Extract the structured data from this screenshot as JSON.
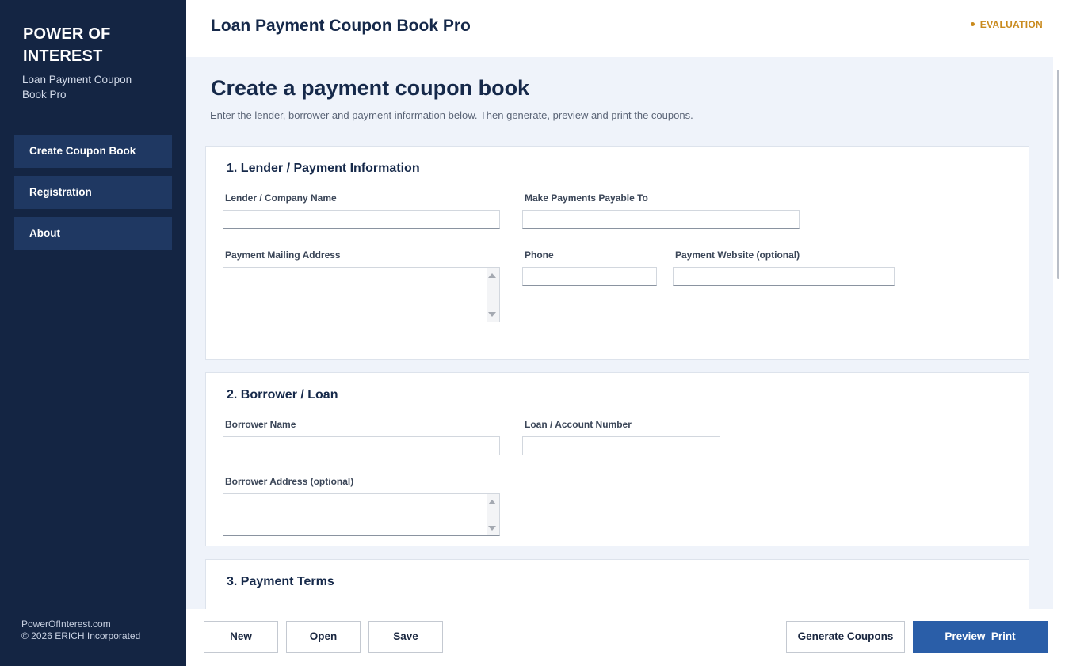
{
  "sidebar": {
    "brand_title": "POWER OF INTEREST",
    "brand_subtitle": "Loan Payment Coupon Book Pro",
    "items": [
      {
        "label": "Create Coupon Book"
      },
      {
        "label": "Registration"
      },
      {
        "label": "About"
      }
    ],
    "footer_website": "PowerOfInterest.com",
    "footer_copyright": "© 2026 ERICH Incorporated"
  },
  "header": {
    "title": "Loan Payment Coupon Book Pro",
    "badge": "EVALUATION"
  },
  "main": {
    "title": "Create a payment coupon book",
    "description": "Enter the lender, borrower and payment information below. Then generate, preview and print the coupons.",
    "sections": {
      "lender": {
        "title": "1. Lender / Payment Information",
        "fields": {
          "company_name": {
            "label": "Lender / Company Name",
            "value": ""
          },
          "payable_to": {
            "label": "Make Payments Payable To",
            "value": ""
          },
          "mailing_address": {
            "label": "Payment Mailing Address",
            "value": ""
          },
          "phone": {
            "label": "Phone",
            "value": ""
          },
          "website": {
            "label": "Payment Website (optional)",
            "value": ""
          }
        }
      },
      "borrower": {
        "title": "2. Borrower / Loan",
        "fields": {
          "borrower_name": {
            "label": "Borrower Name",
            "value": ""
          },
          "account_number": {
            "label": "Loan / Account Number",
            "value": ""
          },
          "borrower_address": {
            "label": "Borrower Address (optional)",
            "value": ""
          }
        }
      },
      "terms": {
        "title": "3. Payment Terms"
      }
    }
  },
  "footer": {
    "new_label": "New",
    "open_label": "Open",
    "save_label": "Save",
    "generate_label": "Generate Coupons",
    "preview_label": "Preview  Print"
  },
  "colors": {
    "sidebar_bg": "#142543",
    "nav_item_bg": "#1f3862",
    "accent_primary": "#2a5ea8",
    "evaluation_badge": "#c98a1d",
    "main_bg": "#eff3fa"
  }
}
